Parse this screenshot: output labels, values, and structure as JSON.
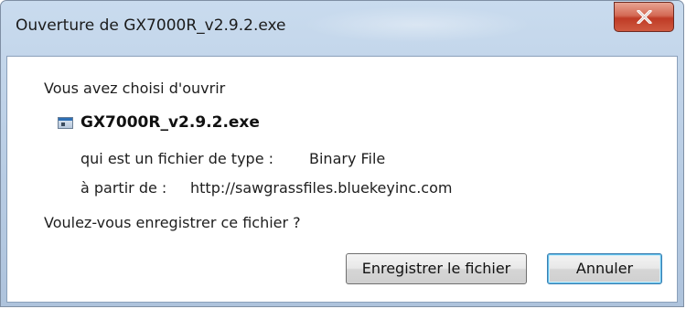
{
  "window": {
    "title": "Ouverture de GX7000R_v2.9.2.exe"
  },
  "dialog": {
    "intro": "Vous avez choisi d'ouvrir",
    "file_name": "GX7000R_v2.9.2.exe",
    "type_label": "qui est un fichier de type :",
    "type_value": "Binary File",
    "source_label": "à partir de :",
    "source_value": "http://sawgrassfiles.bluekeyinc.com",
    "question": "Voulez-vous enregistrer ce fichier ?"
  },
  "buttons": {
    "save_label": "Enregistrer le fichier",
    "cancel_label": "Annuler"
  },
  "icons": {
    "close": "close-icon",
    "file": "exe-file-icon"
  },
  "colors": {
    "title_bar": "#c9dbee",
    "close_button": "#c94a32",
    "default_button_border": "#3c7fb1"
  }
}
